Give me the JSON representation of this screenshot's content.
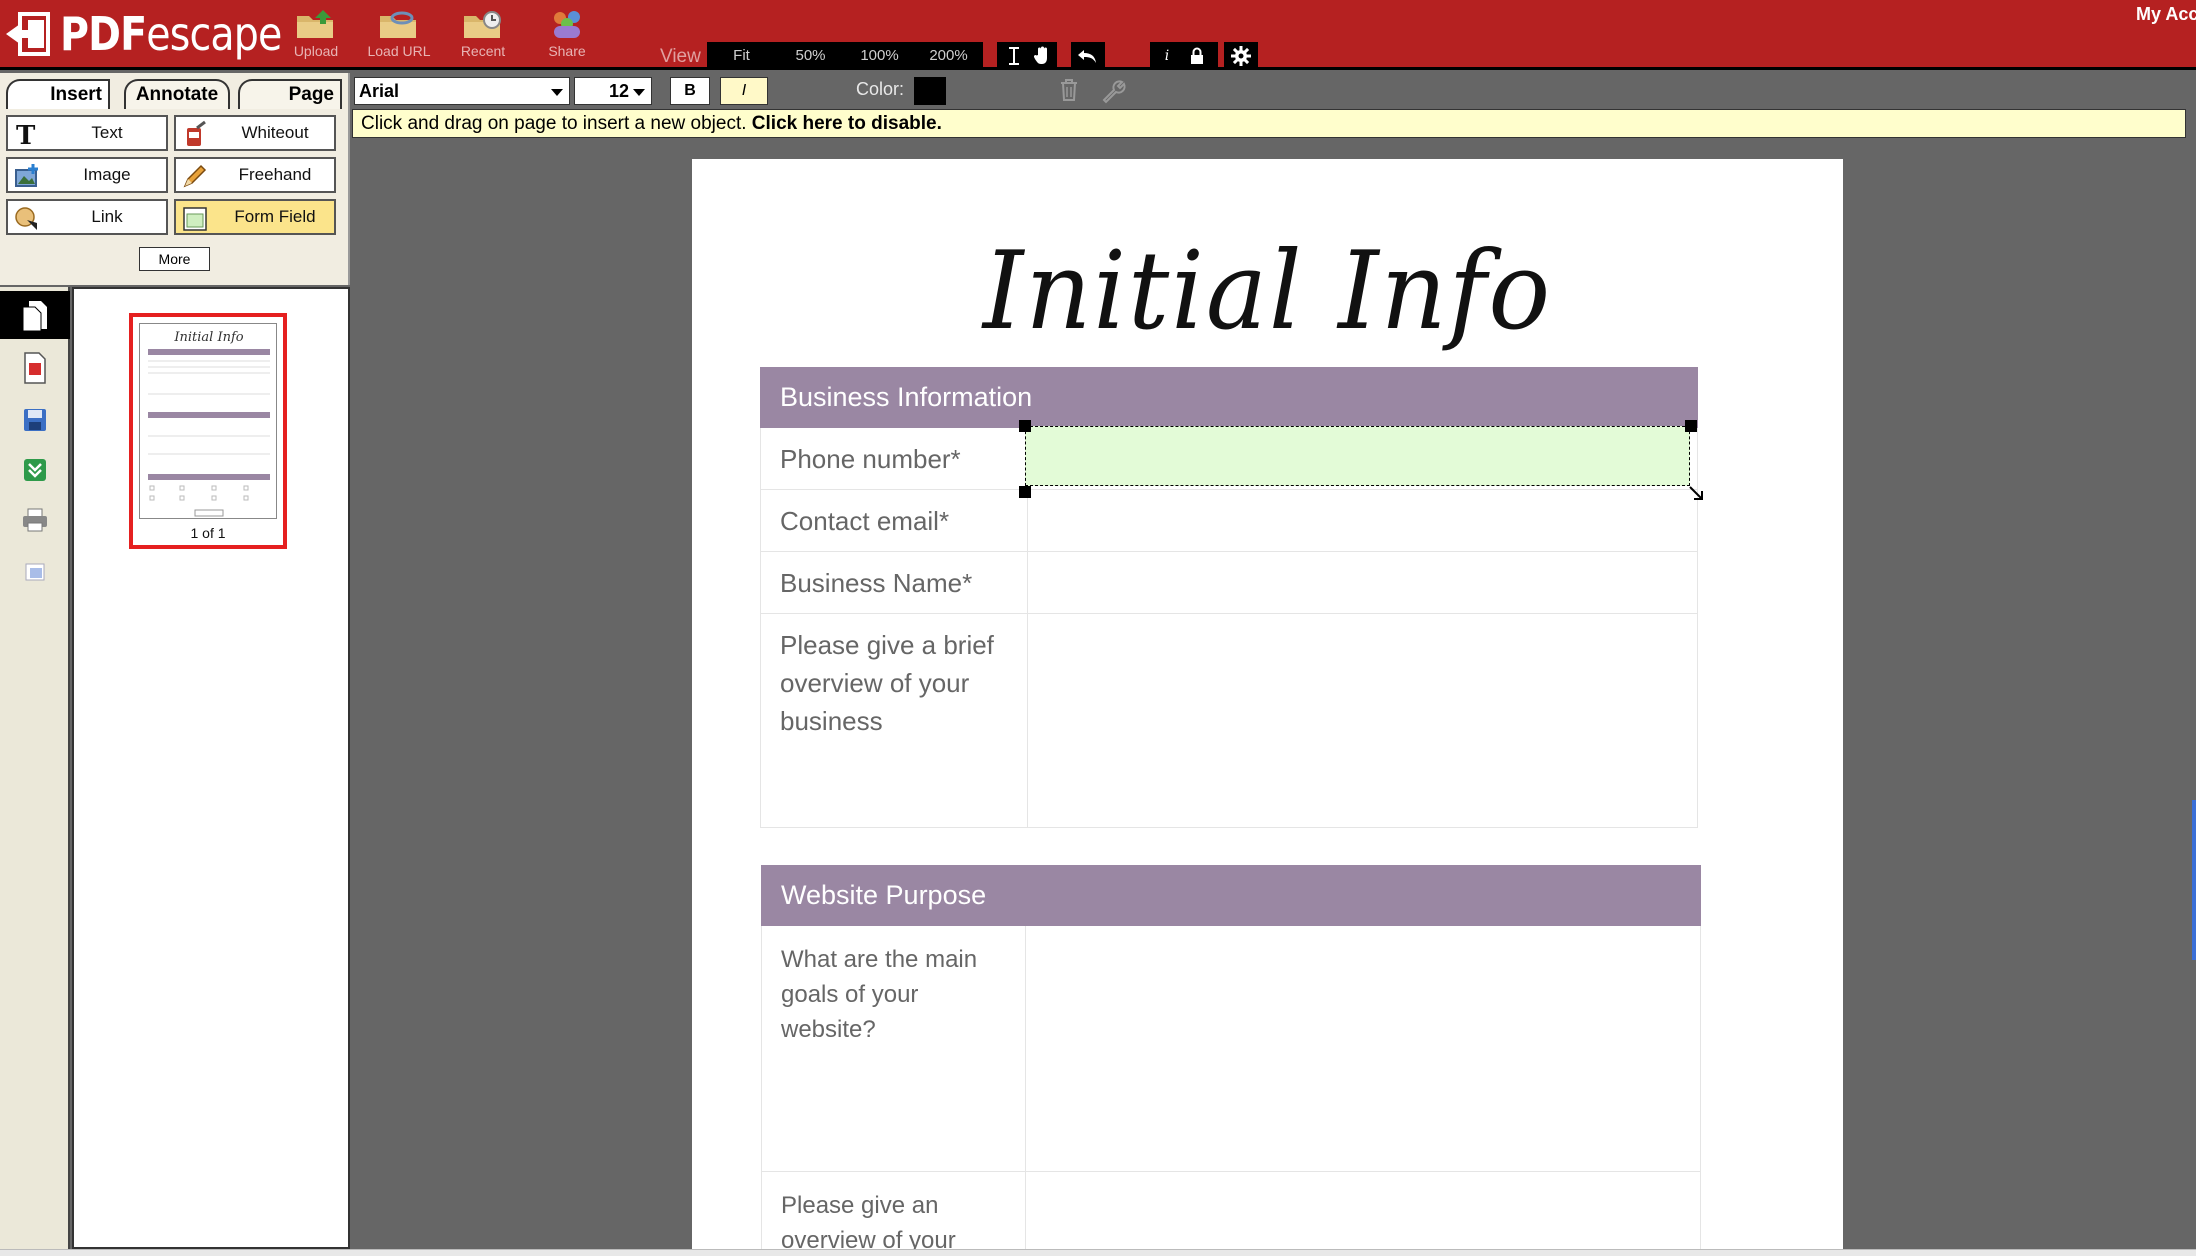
{
  "app": {
    "logo_text_bold": "PDF",
    "logo_text_rest": "escape",
    "my_account": "My Account"
  },
  "topbar": {
    "buttons": [
      {
        "label": "Upload",
        "icon": "upload-folder-icon"
      },
      {
        "label": "Load URL",
        "icon": "load-url-folder-icon"
      },
      {
        "label": "Recent",
        "icon": "recent-folder-icon"
      },
      {
        "label": "Share",
        "icon": "share-people-icon"
      }
    ],
    "view_label": "View",
    "zoom": [
      "Fit",
      "50%",
      "100%",
      "200%"
    ]
  },
  "tabs": {
    "insert": "Insert",
    "annotate": "Annotate",
    "page": "Page"
  },
  "insert_tools": {
    "text": "Text",
    "whiteout": "Whiteout",
    "image": "Image",
    "freehand": "Freehand",
    "link": "Link",
    "form_field": "Form Field",
    "more": "More"
  },
  "format": {
    "font": "Arial",
    "size": "12",
    "bold": "B",
    "italic": "I",
    "color_label": "Color:",
    "color_value": "#000000"
  },
  "infobar": {
    "message": "Click and drag on page to insert a new object.",
    "disable_link": "Click here to disable."
  },
  "thumbnail": {
    "caption": "1 of 1",
    "mini_title": "Initial Info"
  },
  "document": {
    "title": "Initial Info",
    "section1": {
      "header": "Business Information",
      "rows": [
        "Phone number*",
        "Contact email*",
        "Business Name*"
      ],
      "overview_lines": [
        "Please give a brief",
        "overview of your",
        "business"
      ]
    },
    "section2": {
      "header": "Website Purpose",
      "goals_lines": [
        "What are the main",
        "goals of your",
        "website?"
      ],
      "overview_lines": [
        "Please give an",
        "overview of your"
      ]
    }
  },
  "colors": {
    "topbar": "#b52121",
    "section_header": "#9a87a3",
    "form_field_fill": "#e3fbd7",
    "infobar": "#fffecc",
    "active_tool": "#fbe48b"
  }
}
